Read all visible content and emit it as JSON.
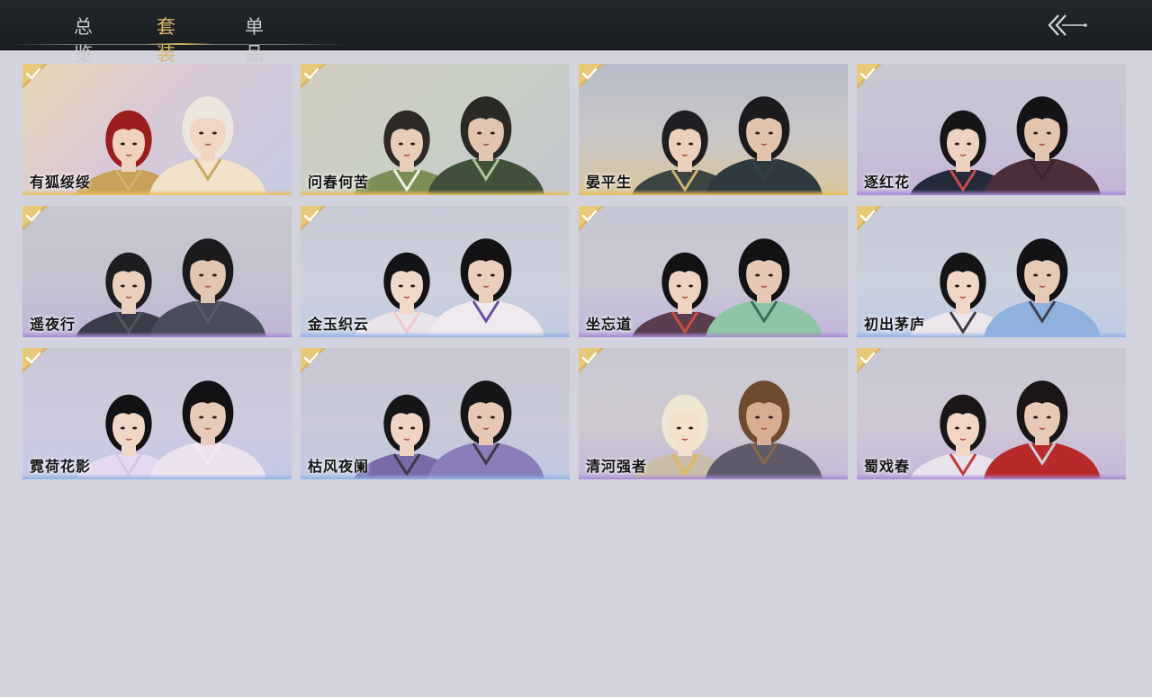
{
  "tabs": [
    {
      "label": "总览",
      "active": false
    },
    {
      "label": "套装",
      "active": true
    },
    {
      "label": "单品",
      "active": false
    }
  ],
  "back_icon": "double-chevron-left-icon",
  "colors": {
    "accent": "#d8b46a",
    "topbar": "#1f2326",
    "background": "#d3d3de"
  },
  "outfits": [
    {
      "name": "有狐绥绥",
      "owned": true,
      "rarity": "gold"
    },
    {
      "name": "问春何苦",
      "owned": true,
      "rarity": "gold"
    },
    {
      "name": "晏平生",
      "owned": true,
      "rarity": "gold"
    },
    {
      "name": "逐红花",
      "owned": true,
      "rarity": "purple"
    },
    {
      "name": "遥夜行",
      "owned": true,
      "rarity": "purple"
    },
    {
      "name": "金玉织云",
      "owned": true,
      "rarity": "blue"
    },
    {
      "name": "坐忘道",
      "owned": true,
      "rarity": "purple"
    },
    {
      "name": "初出茅庐",
      "owned": true,
      "rarity": "blue"
    },
    {
      "name": "霓荷花影",
      "owned": true,
      "rarity": "blue"
    },
    {
      "name": "枯风夜阑",
      "owned": true,
      "rarity": "blue"
    },
    {
      "name": "清河强者",
      "owned": true,
      "rarity": "purple"
    },
    {
      "name": "蜀戏春",
      "owned": true,
      "rarity": "purple"
    }
  ]
}
